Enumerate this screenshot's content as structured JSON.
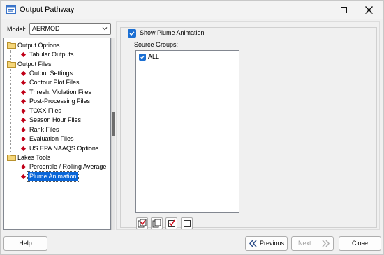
{
  "window": {
    "title": "Output Pathway"
  },
  "model": {
    "label": "Model:",
    "value": "AERMOD"
  },
  "tree": {
    "groups": [
      {
        "label": "Output Options",
        "items": [
          "Tabular Outputs"
        ]
      },
      {
        "label": "Output Files",
        "items": [
          "Output Settings",
          "Contour Plot Files",
          "Thresh. Violation Files",
          "Post-Processing Files",
          "TOXX Files",
          "Season Hour Files",
          "Rank Files",
          "Evaluation Files",
          "US EPA NAAQS Options"
        ]
      },
      {
        "label": "Lakes Tools",
        "items": [
          "Percentile / Rolling Average",
          "Plume Animation"
        ]
      }
    ],
    "selected": "Plume Animation"
  },
  "plume": {
    "show_label": "Show Plume Animation",
    "show_checked": true
  },
  "source_groups": {
    "label": "Source Groups:",
    "items": [
      {
        "label": "ALL",
        "checked": true
      }
    ]
  },
  "toolbar": {
    "icons": [
      "check-all-icon",
      "uncheck-all-icon",
      "check-icon",
      "uncheck-icon"
    ]
  },
  "buttons": {
    "help": "Help",
    "previous": "Previous",
    "next": "Next",
    "close": "Close"
  },
  "colors": {
    "accent": "#1b6fd3",
    "selection": "#0a66d8",
    "diamond": "#c00018"
  }
}
